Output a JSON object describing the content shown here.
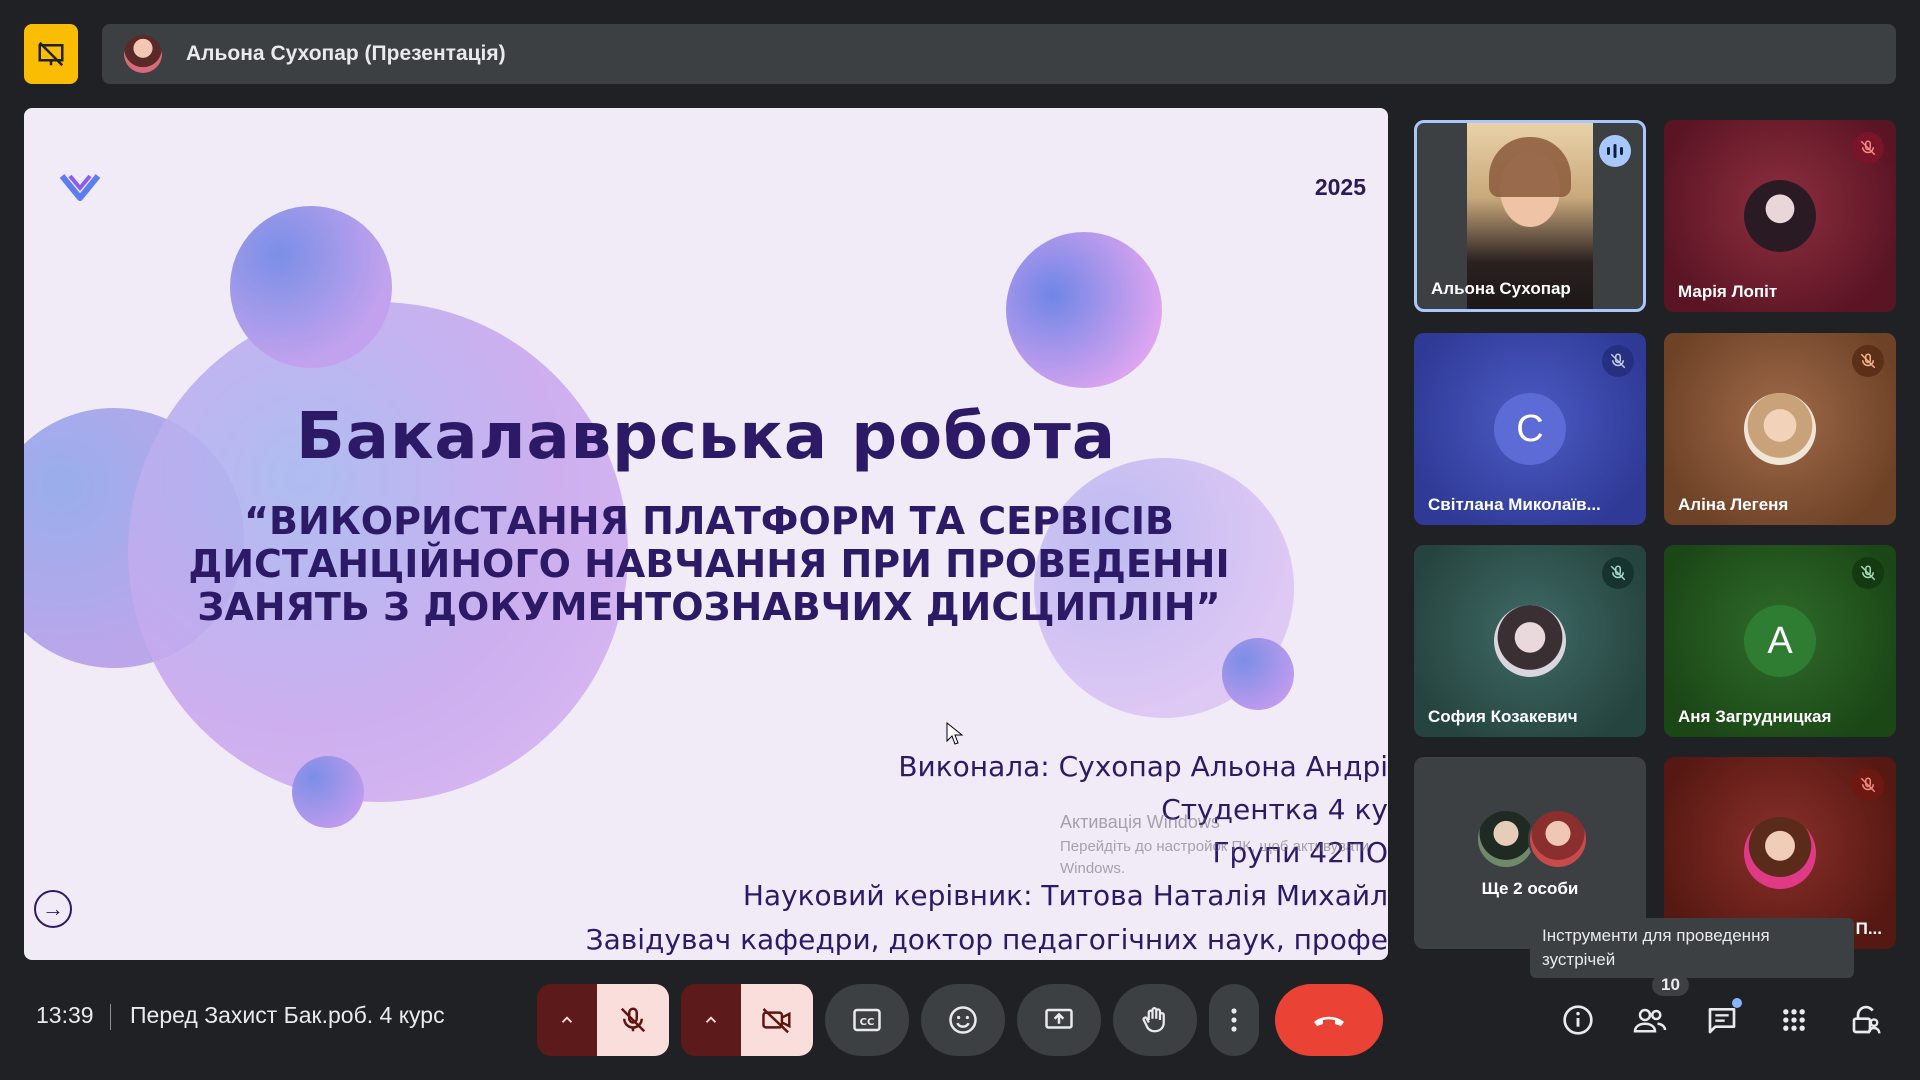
{
  "header": {
    "presenter_title": "Альона Сухопар (Презентація)"
  },
  "slide": {
    "year": "2025",
    "title": "Бакалаврська робота",
    "subtitle_lines": [
      "“ВИКОРИСТАННЯ ПЛАТФОРМ ТА СЕРВІСІВ",
      "ДИСТАНЦІЙНОГО НАВЧАННЯ ПРИ ПРОВЕДЕННІ",
      "ЗАНЯТЬ З ДОКУМЕНТОЗНАВЧИХ ДИСЦИПЛІН”"
    ],
    "info_lines": [
      "Виконала: Сухопар Альона Андрі",
      "Студентка 4 ку",
      "Групи 42ПО",
      "Науковий керівник: Титова Наталія Михайл",
      "Завідувач кафедри, доктор педагогічних наук, профе"
    ],
    "watermark_lines": [
      "Активація Windows",
      "Перейдіть до настройок ПК, щоб активувати",
      "Windows."
    ]
  },
  "participants": [
    {
      "name": "Альона Сухопар",
      "speaking": true
    },
    {
      "name": "Марія Лопіт",
      "muted": true
    },
    {
      "name": "Світлана Миколаїв...",
      "initial": "С",
      "muted": true
    },
    {
      "name": "Аліна Легеня",
      "muted": true
    },
    {
      "name": "София Козакевич",
      "muted": true
    },
    {
      "name": "Аня Загрудницкая",
      "initial": "А",
      "muted": true
    },
    {
      "name": "Ще 2 особи"
    },
    {
      "name": "П...",
      "muted": true
    }
  ],
  "tooltip": {
    "text_line1": "Інструменти для проведення",
    "text_line2": "зустрічей"
  },
  "bottom_bar": {
    "time": "13:39",
    "meeting_title": "Перед Захист Бак.роб. 4 курс",
    "participants_count": "10"
  },
  "colors": {
    "accent_yellow": "#fbbc04",
    "end_call": "#ea4335",
    "muted_pink": "#f9dedc",
    "slide_text": "#2d1a66"
  }
}
